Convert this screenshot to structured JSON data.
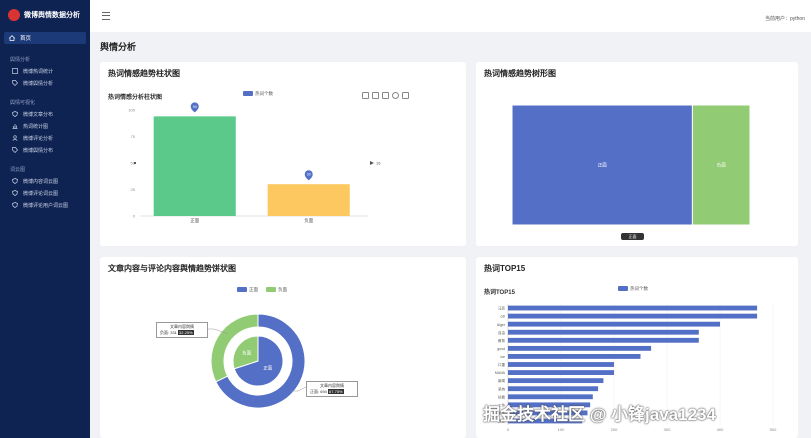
{
  "brand": {
    "title": "微博舆情数据分析"
  },
  "sidebar": {
    "home": "首页",
    "groups": [
      {
        "title": "舆情分析",
        "items": [
          "微博热词统计",
          "微博舆情分析"
        ]
      },
      {
        "title": "舆情可视化",
        "items": [
          "微博文章分布",
          "热词统计图",
          "微博评论分析",
          "微博舆情分布"
        ]
      },
      {
        "title": "词云图",
        "items": [
          "微博内容词云图",
          "微博评论词云图",
          "微博评论用户词云图"
        ]
      }
    ]
  },
  "header": {
    "user": "当前用户：python"
  },
  "page": {
    "title": "舆情分析"
  },
  "card1": {
    "title": "热词情感趋势柱状图",
    "subtitle": "热词情感分析柱状图",
    "legend": "热词个数",
    "markers": [
      "94",
      "30"
    ],
    "side_label": "16"
  },
  "card2": {
    "title": "热词情感趋势树形图",
    "slider_label": "正面"
  },
  "card3": {
    "title": "文章内容与评论内容舆情趋势饼状图",
    "legend": [
      "正面",
      "负面"
    ],
    "tooltip1": {
      "title": "文章内容舆情",
      "key": "负面",
      "value": "331",
      "pct": "32.25%"
    },
    "tooltip2": {
      "title": "文章内容舆情",
      "key": "正面",
      "value": "694",
      "pct": "67.75%"
    },
    "outer_labels": [
      "负面",
      "正面"
    ]
  },
  "card4": {
    "title": "热词TOP15",
    "subtitle": "热词TOP15",
    "legend": "热词个数"
  },
  "watermark": "掘金技术社区 @ 小锋java1234",
  "chart_data": [
    {
      "type": "bar",
      "title": "热词情感分析柱状图",
      "categories": [
        "正面",
        "负面"
      ],
      "series": [
        {
          "name": "热词个数",
          "values": [
            94,
            30
          ]
        }
      ],
      "ylim": [
        0,
        100
      ],
      "yticks": [
        "0",
        "25",
        "50",
        "75",
        "100"
      ],
      "colors": [
        "#5bc98a",
        "#fcc85f"
      ]
    },
    {
      "type": "treemap",
      "categories": [
        "正面",
        "负面"
      ],
      "values": [
        94,
        30
      ],
      "colors": [
        "#5470c6",
        "#91cc75"
      ]
    },
    {
      "type": "pie",
      "series": [
        {
          "name": "文章内容舆情",
          "categories": [
            "正面",
            "负面"
          ],
          "values": [
            694,
            331
          ]
        },
        {
          "name": "评论内容舆情",
          "categories": [
            "正面",
            "负面"
          ],
          "values": [
            70,
            30
          ]
        }
      ],
      "colors": [
        "#5470c6",
        "#91cc75"
      ]
    },
    {
      "type": "bar",
      "orientation": "horizontal",
      "title": "热词TOP15",
      "categories": [
        "马克",
        "cdl",
        "Alger",
        "自由",
        "教育",
        "good",
        "ice",
        "口罩",
        "MANA",
        "新闻",
        "坚持",
        "好看",
        "工作",
        "希望",
        "改变"
      ],
      "values": [
        470,
        470,
        400,
        360,
        360,
        270,
        250,
        200,
        200,
        180,
        170,
        160,
        155,
        150,
        140
      ],
      "xticks": [
        "0",
        "100",
        "200",
        "300",
        "400",
        "500"
      ],
      "xlim": [
        0,
        500
      ],
      "colors": [
        "#5470c6"
      ]
    }
  ]
}
